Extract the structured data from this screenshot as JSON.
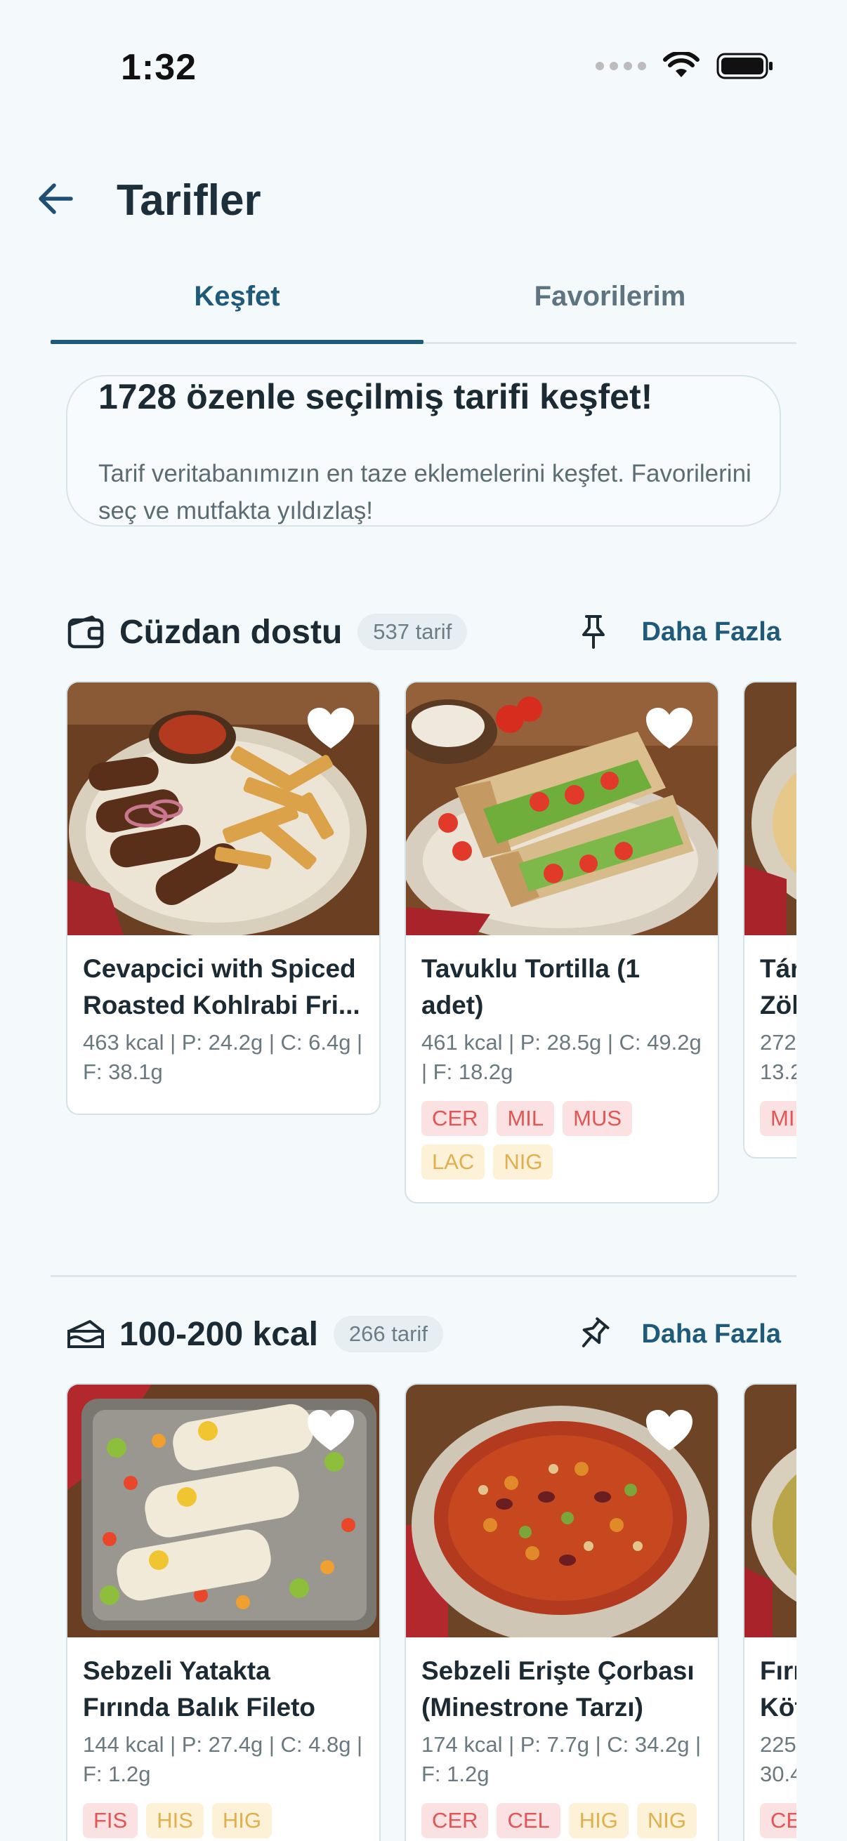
{
  "status_bar": {
    "time": "1:32"
  },
  "header": {
    "title": "Tarifler"
  },
  "tabs": [
    {
      "label": "Keşfet",
      "active": true
    },
    {
      "label": "Favorilerim",
      "active": false
    }
  ],
  "intro": {
    "title": "1728 özenle seçilmiş tarifi keşfet!",
    "subtitle": "Tarif veritabanımızın en taze eklemelerini keşfet. Favorilerini seç ve mutfakta yıldızlaş!"
  },
  "sections": [
    {
      "title": "Cüzdan dostu",
      "icon": "wallet-icon",
      "count": "537 tarif",
      "more_label": "Daha Fazla",
      "cards": [
        {
          "title": "Cevapcici with Spiced Roasted Kohlrabi Fri...",
          "macros": "463 kcal | P: 24.2g | C: 6.4g | F: 38.1g",
          "tags": []
        },
        {
          "title": "Tavuklu Tortilla (1 adet)",
          "macros": "461 kcal | P: 28.5g | C: 49.2g | F: 18.2g",
          "tags": [
            {
              "label": "CER",
              "color": "red"
            },
            {
              "label": "MIL",
              "color": "red"
            },
            {
              "label": "MUS",
              "color": "red"
            },
            {
              "label": "LAC",
              "color": "yellow"
            },
            {
              "label": "NIG",
              "color": "yellow"
            }
          ]
        },
        {
          "title": "Tár\nZöl",
          "macros": "272\n13.2",
          "tags": [
            {
              "label": "MI",
              "color": "red"
            }
          ]
        }
      ]
    },
    {
      "title": "100-200 kcal",
      "icon": "cake-slice-icon",
      "count": "266 tarif",
      "more_label": "Daha Fazla",
      "cards": [
        {
          "title": "Sebzeli Yatakta Fırında Balık Fileto",
          "macros": "144 kcal | P: 27.4g | C: 4.8g | F: 1.2g",
          "tags": [
            {
              "label": "FIS",
              "color": "red"
            },
            {
              "label": "HIS",
              "color": "yellow"
            },
            {
              "label": "HIG",
              "color": "yellow"
            }
          ]
        },
        {
          "title": "Sebzeli Erişte Çorbası (Minestrone Tarzı)",
          "macros": "174 kcal | P: 7.7g | C: 34.2g | F: 1.2g",
          "tags": [
            {
              "label": "CER",
              "color": "red"
            },
            {
              "label": "CEL",
              "color": "red"
            },
            {
              "label": "HIG",
              "color": "yellow"
            },
            {
              "label": "NIG",
              "color": "yellow"
            }
          ]
        },
        {
          "title": "Fırı\nKöf",
          "macros": "225\n30.4",
          "tags": [
            {
              "label": "CE",
              "color": "red"
            }
          ]
        }
      ]
    }
  ]
}
